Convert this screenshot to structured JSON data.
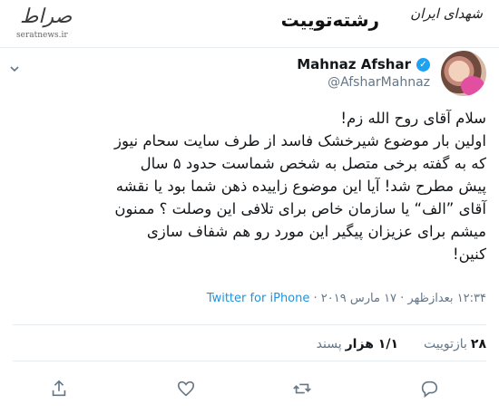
{
  "header": {
    "title": "رشته‌توییت",
    "logo_text": "صراط",
    "logo_site": "seratnews.ir",
    "watermark": "شهدای ایران"
  },
  "tweet": {
    "author_name": "Mahnaz Afshar",
    "author_handle": "@AfsharMahnaz",
    "lines": [
      "سلام آقای روح الله زم!",
      "اولین بار موضوع شیرخشک فاسد از طرف سایت سحام نیوز",
      "که به گفته برخی متصل به شخص شماست حدود ۵ سال",
      "پیش مطرح شد! آیا این موضوع زاییده ذهن شما بود یا نقشه",
      "آقای ”الف“ یا سازمان خاص برای تلافی این وصلت ؟ ممنون",
      "میشم برای عزیزان پیگیر این مورد رو هم شفاف سازی",
      "کنین!"
    ],
    "time_date": "۱۲:۳۴ بعدازظهر · ۱۷ مارس ۲۰۱۹ ·",
    "client": "Twitter for iPhone",
    "retweets_count": "۲۸",
    "retweets_label": "بازتوییت",
    "likes_count": "۱/۱ هزار",
    "likes_label": "پسند"
  },
  "icons": {
    "reply": "reply-icon",
    "retweet": "retweet-icon",
    "like": "heart-icon",
    "share": "share-icon",
    "verified": "verified-badge-icon",
    "more": "chevron-down-icon"
  },
  "colors": {
    "link": "#1b95e0",
    "verified": "#1da1f2",
    "muted": "#657786",
    "text": "#14171a"
  }
}
